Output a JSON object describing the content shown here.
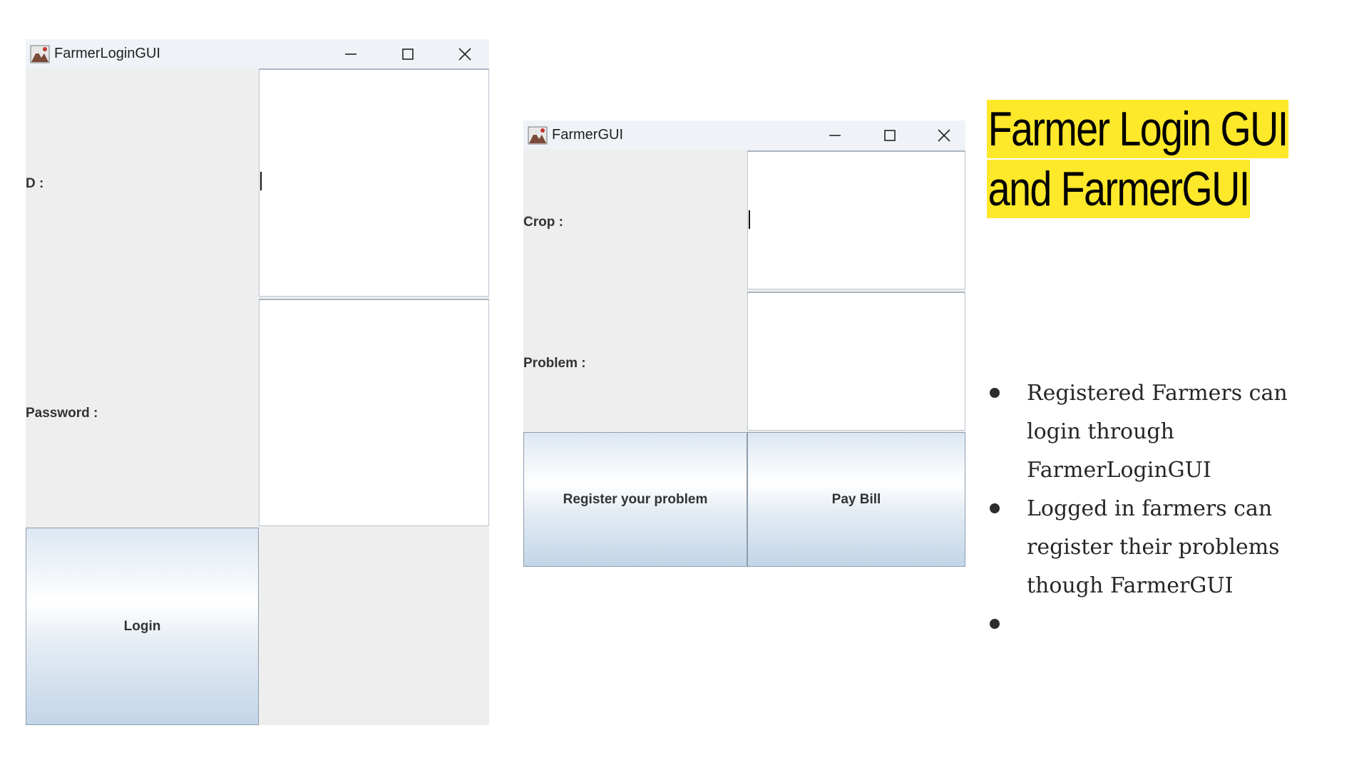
{
  "login_window": {
    "title": "FarmerLoginGUI",
    "id_label": "D :",
    "id_value": "",
    "password_label": "Password :",
    "password_value": "",
    "login_button": "Login"
  },
  "farmer_window": {
    "title": "FarmerGUI",
    "crop_label": "Crop :",
    "crop_value": "",
    "problem_label": "Problem :",
    "problem_value": "",
    "register_button": "Register your problem",
    "pay_bill_button": "Pay Bill"
  },
  "slide": {
    "title_line1": "Farmer Login GUI",
    "title_line2": "and FarmerGUI",
    "bullets": [
      "Registered Farmers can login through FarmerLoginGUI",
      "Logged in farmers can register their problems though FarmerGUI",
      ""
    ]
  },
  "icons": {
    "app": "java-app-icon",
    "minimize": "minimize-icon",
    "maximize": "maximize-icon",
    "close": "close-icon"
  },
  "colors": {
    "highlight": "#fde82a",
    "titlebar": "#eff3f8",
    "panel": "#eeeeee"
  }
}
